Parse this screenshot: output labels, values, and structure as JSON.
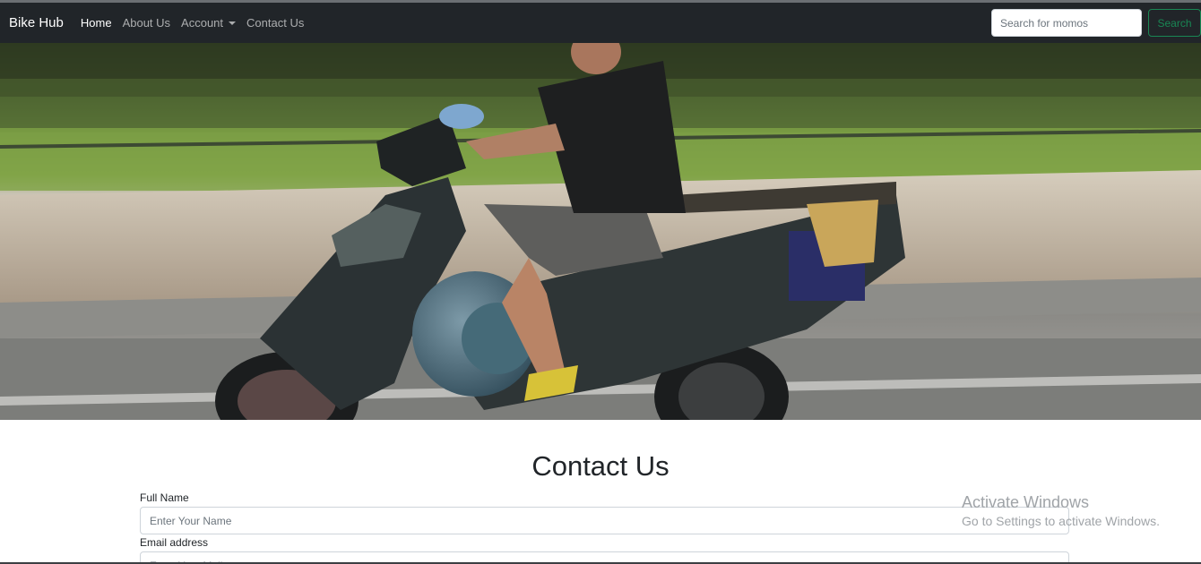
{
  "navbar": {
    "brand": "Bike Hub",
    "items": [
      {
        "label": "Home",
        "active": true
      },
      {
        "label": "About Us",
        "active": false
      },
      {
        "label": "Account",
        "active": false,
        "dropdown": true
      },
      {
        "label": "Contact Us",
        "active": false
      }
    ],
    "search_placeholder": "Search for momos",
    "search_button": "Search"
  },
  "main": {
    "title": "Contact Us",
    "fields": [
      {
        "label": "Full Name",
        "placeholder": "Enter Your Name"
      },
      {
        "label": "Email address",
        "placeholder": "Enter Your Mail"
      }
    ]
  },
  "watermark": {
    "title": "Activate Windows",
    "subtitle": "Go to Settings to activate Windows."
  },
  "colors": {
    "navbar_bg": "#212529",
    "search_button": "#198754"
  }
}
